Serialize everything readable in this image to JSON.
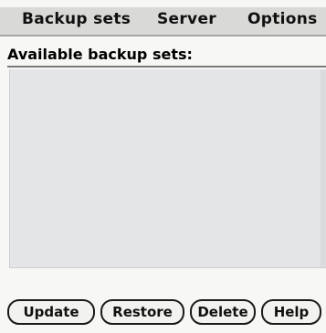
{
  "menubar": {
    "items": [
      {
        "label": "Backup sets"
      },
      {
        "label": "Server"
      },
      {
        "label": "Options"
      }
    ]
  },
  "main": {
    "heading": "Available backup sets:",
    "backup_sets": []
  },
  "buttons": {
    "update": "Update",
    "restore": "Restore",
    "delete": "Delete",
    "help": "Help"
  },
  "colors": {
    "menubar_bg": "#d9d9d7",
    "list_bg": "#e4e5e6",
    "button_border": "#1a1a1a"
  }
}
